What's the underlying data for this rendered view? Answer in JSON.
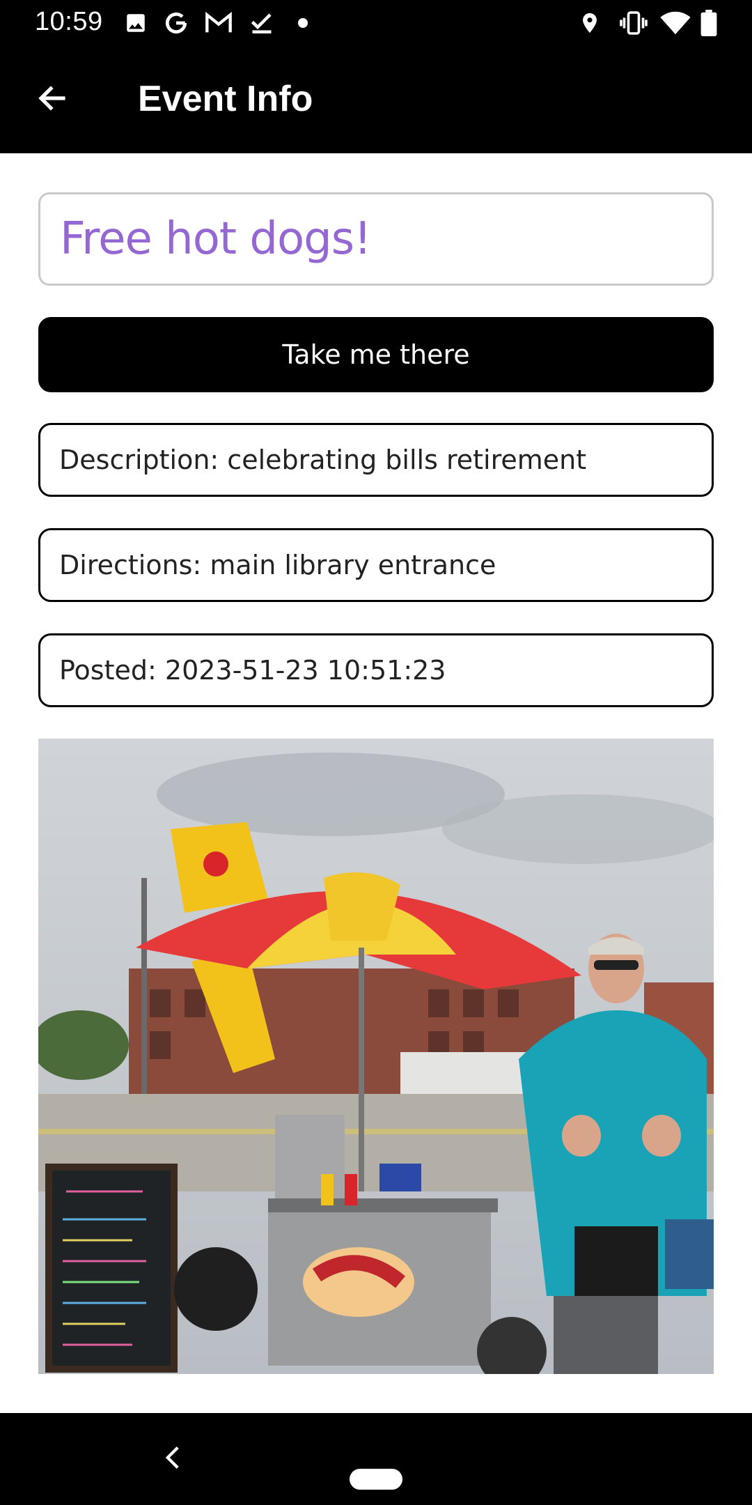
{
  "status_bar": {
    "time": "10:59",
    "left_icons": [
      "image-icon",
      "google-icon",
      "gmail-icon",
      "checkmark-icon",
      "dot-icon"
    ],
    "right_icons": [
      "location-icon",
      "vibrate-icon",
      "wifi-icon",
      "battery-icon"
    ]
  },
  "app_bar": {
    "title": "Event Info",
    "back_icon": "arrow-left-icon"
  },
  "event": {
    "title": "Free hot dogs!",
    "take_me_there_label": "Take me there",
    "description": "Description: celebrating bills retirement",
    "directions": "Directions: main library entrance",
    "posted": "Posted: 2023-51-23 10:51:23"
  },
  "photo": {
    "subject": "hot-dog-cart-photo"
  },
  "colors": {
    "title_accent": "#9467d3",
    "bar_background": "#000000",
    "button_background": "#000000"
  },
  "nav_bar": {
    "back_icon": "chevron-left-icon",
    "home_icon": "home-pill-icon"
  }
}
